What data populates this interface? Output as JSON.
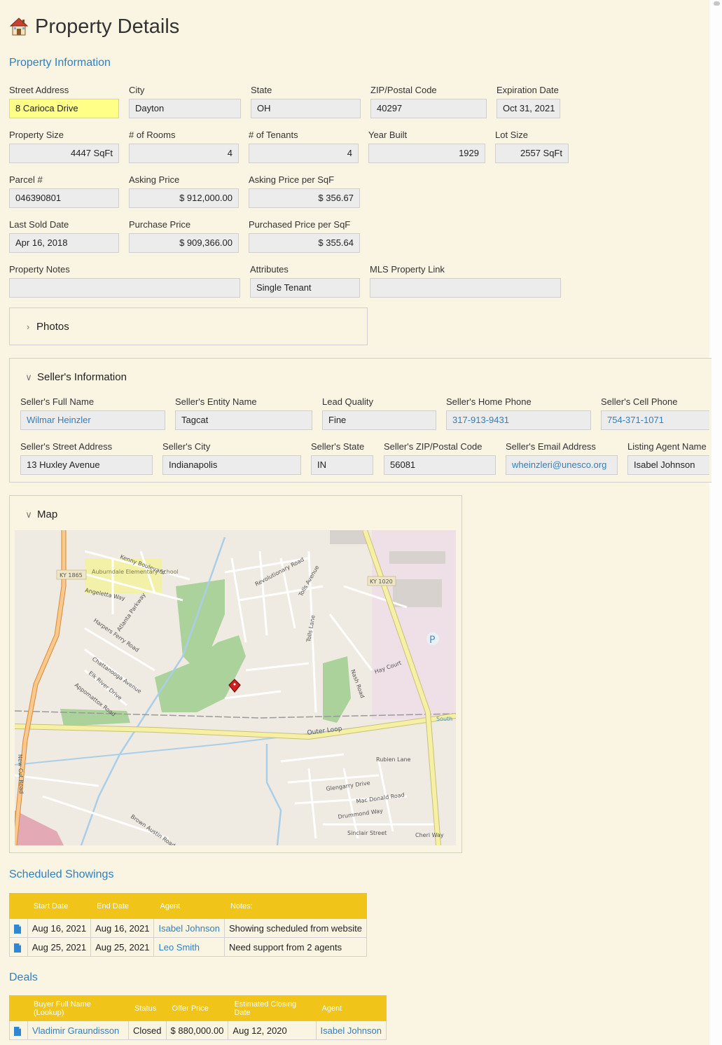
{
  "page": {
    "title": "Property Details",
    "title_icon": "house-icon"
  },
  "property_info": {
    "title": "Property Information",
    "street_address": {
      "label": "Street Address",
      "value": "8 Carioca Drive"
    },
    "city": {
      "label": "City",
      "value": "Dayton"
    },
    "state": {
      "label": "State",
      "value": "OH"
    },
    "zip": {
      "label": "ZIP/Postal Code",
      "value": "40297"
    },
    "expiration_date": {
      "label": "Expiration Date",
      "value": "Oct 31, 2021"
    },
    "property_size": {
      "label": "Property Size",
      "value": "4447 SqFt"
    },
    "rooms": {
      "label": "#  of Rooms",
      "value": "4"
    },
    "tenants": {
      "label": "# of Tenants",
      "value": "4"
    },
    "year_built": {
      "label": "Year Built",
      "value": "1929"
    },
    "lot_size": {
      "label": "Lot Size",
      "value": "2557 SqFt"
    },
    "parcel": {
      "label": "Parcel #",
      "value": "046390801"
    },
    "asking_price": {
      "label": "Asking Price",
      "value": "$ 912,000.00"
    },
    "asking_price_sqf": {
      "label": "Asking Price per SqF",
      "value": "$ 356.67"
    },
    "last_sold_date": {
      "label": "Last Sold Date",
      "value": "Apr 16, 2018"
    },
    "purchase_price": {
      "label": "Purchase Price",
      "value": "$ 909,366.00"
    },
    "purchased_price_sqf": {
      "label": "Purchased Price per SqF",
      "value": "$ 355.64"
    },
    "notes": {
      "label": "Property Notes",
      "value": ""
    },
    "attributes": {
      "label": "Attributes",
      "value": "Single Tenant"
    },
    "mls_link": {
      "label": "MLS Property Link",
      "value": ""
    }
  },
  "photos": {
    "title": "Photos"
  },
  "seller": {
    "title": "Seller's Information",
    "full_name": {
      "label": "Seller's Full Name",
      "value": "Wilmar Heinzler"
    },
    "entity_name": {
      "label": "Seller's Entity Name",
      "value": "Tagcat"
    },
    "lead_quality": {
      "label": "Lead Quality",
      "value": "Fine"
    },
    "home_phone": {
      "label": "Seller's Home Phone",
      "value": "317-913-9431"
    },
    "cell_phone": {
      "label": "Seller's Cell Phone",
      "value": "754-371-1071"
    },
    "street": {
      "label": "Seller's Street Address",
      "value": "13 Huxley Avenue"
    },
    "city": {
      "label": "Seller's City",
      "value": "Indianapolis"
    },
    "state": {
      "label": "Seller's State",
      "value": "IN"
    },
    "zip": {
      "label": "Seller's ZIP/Postal Code",
      "value": "56081"
    },
    "email": {
      "label": "Seller's Email Address",
      "value": "wheinzleri@unesco.org"
    },
    "agent": {
      "label": "Listing Agent Name",
      "value": "Isabel Johnson"
    }
  },
  "map": {
    "title": "Map",
    "labels": {
      "ky1865": "KY 1865",
      "ky1020": "KY 1020",
      "school": "Auburndale Elementary School",
      "kenny": "Kenny Boulevard",
      "revolutionary": "Revolutionary Road",
      "outer_loop": "Outer Loop",
      "rubien": "Rubien Lane",
      "glengarry": "Glengarry Drive",
      "mac_donald": "Mac Donald Road",
      "drummond": "Drummond Way",
      "sinclair": "Sinclair Street",
      "hay": "Hay Court",
      "nash": "Nash Road",
      "tolls": "Tolls Lane",
      "tolls_ave": "Tolls Avenue",
      "harpers": "Harpers Ferry Road",
      "atlanta": "Atlanta Parkway",
      "chattanooga": "Chattanooga Avenue",
      "elk": "Elk River Drive",
      "appomattox": "Appomattox Road",
      "angeletta": "Angeletta Way",
      "brown_austin": "Brown Austin Road",
      "new_cut": "New Cut Road",
      "south": "South",
      "cheri": "Cheri Way",
      "parking": "P"
    }
  },
  "showings": {
    "title": "Scheduled Showings",
    "columns": [
      "Start Date",
      "End Date",
      "Agent",
      "Notes:"
    ],
    "rows": [
      {
        "start": "Aug 16, 2021",
        "end": "Aug 16, 2021",
        "agent": "Isabel Johnson",
        "notes": "Showing scheduled from website"
      },
      {
        "start": "Aug 25, 2021",
        "end": "Aug 25, 2021",
        "agent": "Leo Smith",
        "notes": "Need support from 2 agents"
      }
    ]
  },
  "deals": {
    "title": "Deals",
    "columns": [
      "Buyer Full Name (Lookup)",
      "Status",
      "Offer Price",
      "Estimated Closing Date",
      "Agent"
    ],
    "rows": [
      {
        "buyer": "Vladimir Graundisson",
        "status": "Closed",
        "price": "$ 880,000.00",
        "closing": "Aug 12, 2020",
        "agent": "Isabel Johnson"
      }
    ]
  },
  "colors": {
    "accent": "#2f7fc1",
    "table_header": "#f0c419",
    "background": "#faf5e2",
    "highlight": "#ffff88"
  }
}
